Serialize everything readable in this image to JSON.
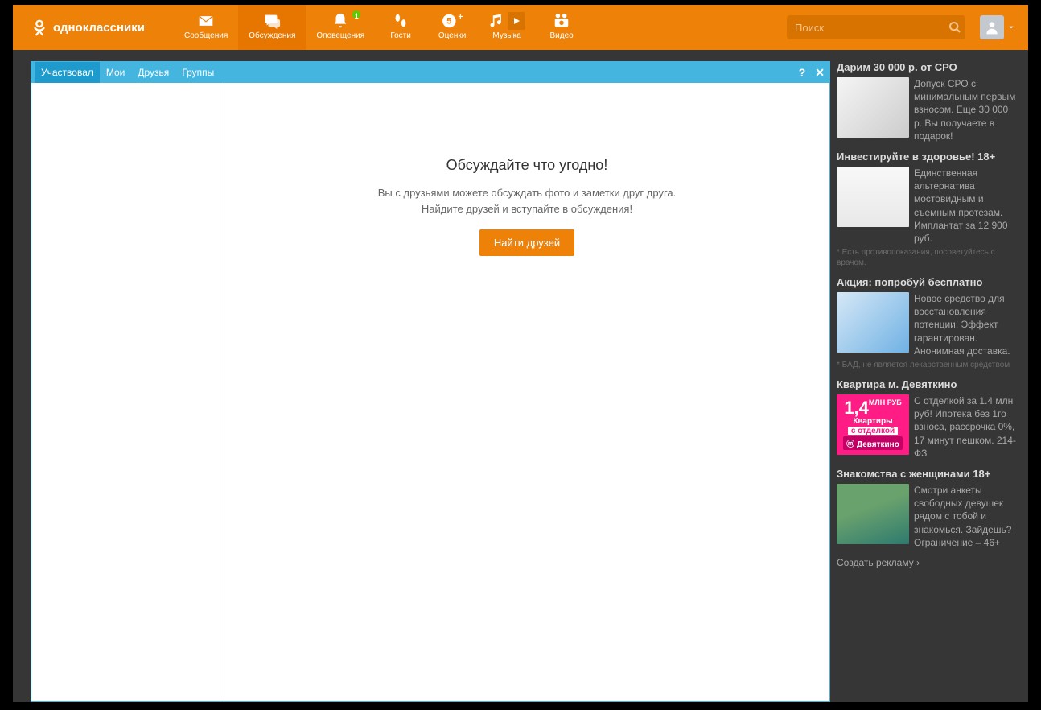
{
  "brand": {
    "name": "одноклассники"
  },
  "nav": {
    "items": [
      {
        "label": "Сообщения",
        "icon": "envelope"
      },
      {
        "label": "Обсуждения",
        "icon": "comments",
        "active": true
      },
      {
        "label": "Оповещения",
        "icon": "bell",
        "badge": "1"
      },
      {
        "label": "Гости",
        "icon": "footprints"
      },
      {
        "label": "Оценки",
        "icon": "five-plus"
      },
      {
        "label": "Музыка",
        "icon": "musicnote",
        "play": true
      },
      {
        "label": "Видео",
        "icon": "videocam"
      }
    ]
  },
  "search": {
    "placeholder": "Поиск"
  },
  "panel": {
    "tabs": [
      {
        "label": "Участвовал",
        "active": true
      },
      {
        "label": "Мои"
      },
      {
        "label": "Друзья"
      },
      {
        "label": "Группы"
      }
    ],
    "help": "?",
    "close": "✕",
    "empty": {
      "title": "Обсуждайте что угодно!",
      "line1": "Вы с друзьями можете обсуждать фото и заметки друг друга.",
      "line2": "Найдите друзей и вступайте в обсуждения!",
      "button": "Найти друзей"
    }
  },
  "ads": [
    {
      "title": "Дарим 30 000 р. от СРО",
      "text": "Допуск СРО с минимальным первым взносом. Еще 30 000 р. Вы получаете в подарок!",
      "img": "tools"
    },
    {
      "title": "Инвестируйте в здоровье! 18+",
      "text": "Единственная альтернатива мостовидным и съемным протезам. Имплантат за 12 900 руб.",
      "disclaimer": "* Есть противопоказания, посоветуйтесь с врачом.",
      "img": "tooth"
    },
    {
      "title": "Акция: попробуй бесплатно",
      "text": "Новое средство для восстановления потенции! Эффект гарантирован. Анонимная доставка.",
      "disclaimer": "* БАД, не является лекарственным средством",
      "img": "blue"
    },
    {
      "title": "Квартира м. Девяткино",
      "text": "С отделкой за 1.4 млн руб! Ипотека без 1го взноса, рассрочка 0%, 17 минут пешком. 214-ФЗ",
      "img": "pink",
      "pink_big": "1,4",
      "pink_unit": "МЛН РУБ",
      "pink_l2": "Квартиры",
      "pink_l3": "с отделкой",
      "pink_l4": "Девяткино"
    },
    {
      "title": "Знакомства с женщинами 18+",
      "text": "Смотри анкеты свободных девушек рядом с тобой и знакомься. Зайдешь? Ограничение – 46+",
      "img": "photo"
    }
  ],
  "ad_create": "Создать рекламу ›"
}
